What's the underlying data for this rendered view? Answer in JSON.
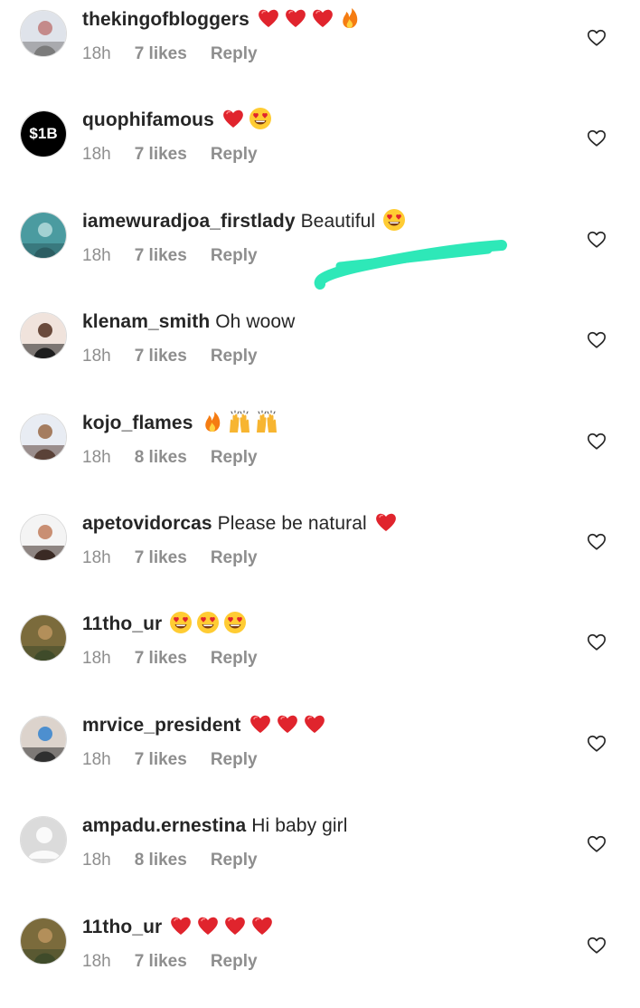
{
  "comments": [
    {
      "username": "thekingofbloggers",
      "text": "",
      "emojis": [
        "heart",
        "heart",
        "heart",
        "fire"
      ],
      "time": "18h",
      "likes": "7 likes",
      "reply": "Reply"
    },
    {
      "username": "quophifamous",
      "text": "",
      "emojis": [
        "heart",
        "heart-eyes"
      ],
      "time": "18h",
      "likes": "7 likes",
      "reply": "Reply",
      "avatar_text": "$1B"
    },
    {
      "username": "iamewuradjoa_firstlady",
      "text": "Beautiful",
      "emojis": [
        "heart-eyes"
      ],
      "time": "18h",
      "likes": "7 likes",
      "reply": "Reply"
    },
    {
      "username": "klenam_smith",
      "text": "Oh woow",
      "emojis": [],
      "time": "18h",
      "likes": "7 likes",
      "reply": "Reply"
    },
    {
      "username": "kojo_flames",
      "text": "",
      "emojis": [
        "fire",
        "raised-hands",
        "raised-hands"
      ],
      "time": "18h",
      "likes": "8 likes",
      "reply": "Reply"
    },
    {
      "username": "apetovidorcas",
      "text": "Please be natural",
      "emojis": [
        "heart"
      ],
      "time": "18h",
      "likes": "7 likes",
      "reply": "Reply"
    },
    {
      "username": "11tho_ur",
      "text": "",
      "emojis": [
        "heart-eyes",
        "heart-eyes",
        "heart-eyes"
      ],
      "time": "18h",
      "likes": "7 likes",
      "reply": "Reply"
    },
    {
      "username": "mrvice_president",
      "text": "",
      "emojis": [
        "heart",
        "heart",
        "heart"
      ],
      "time": "18h",
      "likes": "7 likes",
      "reply": "Reply"
    },
    {
      "username": "ampadu.ernestina",
      "text": "Hi baby girl",
      "emojis": [],
      "time": "18h",
      "likes": "8 likes",
      "reply": "Reply"
    },
    {
      "username": "11tho_ur",
      "text": "",
      "emojis": [
        "heart",
        "heart",
        "heart",
        "heart"
      ],
      "time": "18h",
      "likes": "7 likes",
      "reply": "Reply"
    }
  ],
  "colors": {
    "text": "#262626",
    "meta": "#8e8e8e",
    "heart_emoji": "#e0242d",
    "scribble": "#2ee8b8"
  },
  "icons": {
    "like": "heart-outline-icon"
  }
}
